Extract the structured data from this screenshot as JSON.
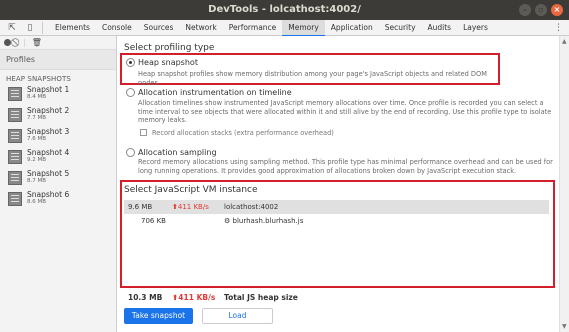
{
  "window": {
    "title": "DevTools - lolcathost:4002/"
  },
  "tabs": [
    {
      "label": "Elements"
    },
    {
      "label": "Console"
    },
    {
      "label": "Sources"
    },
    {
      "label": "Network"
    },
    {
      "label": "Performance"
    },
    {
      "label": "Memory"
    },
    {
      "label": "Application"
    },
    {
      "label": "Security"
    },
    {
      "label": "Audits"
    },
    {
      "label": "Layers"
    }
  ],
  "active_tab": "Memory",
  "sidebar": {
    "profiles_label": "Profiles",
    "heap_header": "HEAP SNAPSHOTS",
    "snapshots": [
      {
        "title": "Snapshot 1",
        "size": "8.4 MB"
      },
      {
        "title": "Snapshot 2",
        "size": "7.7 MB"
      },
      {
        "title": "Snapshot 3",
        "size": "7.6 MB"
      },
      {
        "title": "Snapshot 4",
        "size": "9.2 MB"
      },
      {
        "title": "Snapshot 5",
        "size": "8.7 MB"
      },
      {
        "title": "Snapshot 6",
        "size": "8.6 MB"
      }
    ]
  },
  "main": {
    "select_type_title": "Select profiling type",
    "options": [
      {
        "title": "Heap snapshot",
        "description": "Heap snapshot profiles show memory distribution among your page's JavaScript objects and related DOM nodes.",
        "selected": true
      },
      {
        "title": "Allocation instrumentation on timeline",
        "description": "Allocation timelines show instrumented JavaScript memory allocations over time. Once profile is recorded you can select a time interval to see objects that were allocated within it and still alive by the end of recording. Use this profile type to isolate memory leaks.",
        "selected": false
      },
      {
        "title": "Allocation sampling",
        "description": "Record memory allocations using sampling method. This profile type has minimal performance overhead and can be used for long running operations. It provides good approximation of allocations broken down by JavaScript execution stack.",
        "selected": false
      }
    ],
    "record_stacks_label": "Record allocation stacks (extra performance overhead)",
    "vm_title": "Select JavaScript VM instance",
    "vm_instances": [
      {
        "size": "9.6 MB",
        "rate": "411 KB/s",
        "name": "lolcathost:4002",
        "selected": true
      },
      {
        "size": "706 KB",
        "rate": "",
        "name": "blurhash.blurhash.js",
        "selected": false
      }
    ],
    "total": {
      "size": "10.3 MB",
      "rate": "411 KB/s",
      "label": "Total JS heap size"
    },
    "take_snapshot_label": "Take snapshot",
    "load_label": "Load"
  },
  "colors": {
    "accent": "#1a73e8",
    "highlight_box": "#d31e2b",
    "rate": "#e53935"
  }
}
